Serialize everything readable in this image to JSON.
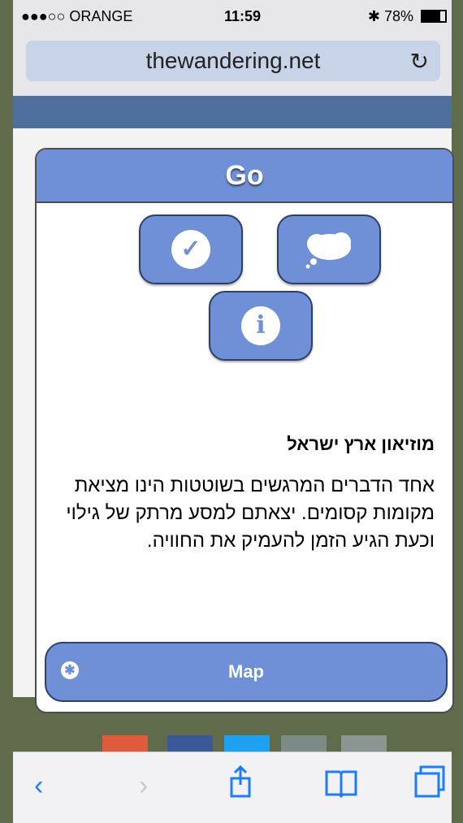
{
  "status": {
    "carrier": "●●●○○ ORANGE",
    "time": "11:59",
    "battery": "78%"
  },
  "browser": {
    "url": "thewandering.net",
    "reload_icon": "reload-icon"
  },
  "card": {
    "title": "Go",
    "buttons": {
      "check": "check-icon",
      "thought": "thought-bubble-icon",
      "info": "info-icon"
    },
    "heading": "מוזיאון ארץ ישראל",
    "paragraph": "אחד הדברים המרגשים בשוטטות הינו מציאת מקומות קסומים. יצאתם למסע מרתק של גילוי וכעת הגיע הזמן להעמיק את החוויה.",
    "map_label": "Map"
  },
  "colors": {
    "accent": "#6f8fd6",
    "accentDark": "#2d3f6b",
    "band": "#4f6f9f"
  }
}
